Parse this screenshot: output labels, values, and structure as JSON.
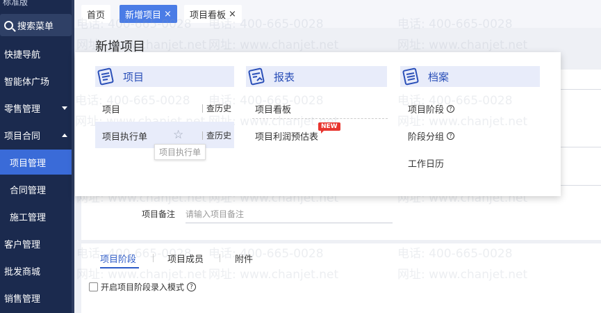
{
  "sidebar": {
    "edition": "标准版",
    "search_label": "搜索菜单",
    "items": [
      {
        "label": "快捷导航"
      },
      {
        "label": "智能体广场"
      },
      {
        "label": "零售管理"
      },
      {
        "label": "项目合同"
      },
      {
        "label": "项目管理"
      },
      {
        "label": "合同管理"
      },
      {
        "label": "施工管理"
      },
      {
        "label": "客户管理"
      },
      {
        "label": "批发商城"
      },
      {
        "label": "销售管理"
      }
    ]
  },
  "tabs": [
    {
      "label": "首页"
    },
    {
      "label": "新增项目",
      "close": "×"
    },
    {
      "label": "项目看板",
      "close": "×"
    }
  ],
  "page": {
    "title": "新增项目",
    "remark_label": "项目备注",
    "remark_placeholder": "请输入项目备注",
    "form_tabs": [
      {
        "label": "项目阶段"
      },
      {
        "label": "项目成员"
      },
      {
        "label": "附件"
      }
    ],
    "checkbox_label": "开启项目阶段录入模式",
    "help_glyph": "?"
  },
  "watermark": {
    "phone": "电话: 400-665-0028",
    "site": "网址: www.chanjet.net"
  },
  "dropdown": {
    "columns": [
      {
        "title": "项目",
        "icon": "project-doc-icon"
      },
      {
        "title": "报表",
        "icon": "report-doc-icon"
      },
      {
        "title": "档案",
        "icon": "archive-doc-icon"
      }
    ],
    "project_items": [
      {
        "label": "项目",
        "history": "查历史"
      },
      {
        "label": "项目执行单",
        "history": "查历史"
      }
    ],
    "report_items": [
      {
        "label": "项目看板"
      },
      {
        "label": "项目利润预估表",
        "badge": "NEW"
      }
    ],
    "archive_items": [
      {
        "label": "项目阶段"
      },
      {
        "label": "阶段分组"
      },
      {
        "label": "工作日历"
      }
    ],
    "tooltip": "项目执行单",
    "star_glyph": "☆"
  },
  "colors": {
    "sidebar_bg": "#1b2a4e",
    "accent": "#3a6bd8",
    "tab_active": "#4a7ce6",
    "badge": "#e8352f"
  }
}
